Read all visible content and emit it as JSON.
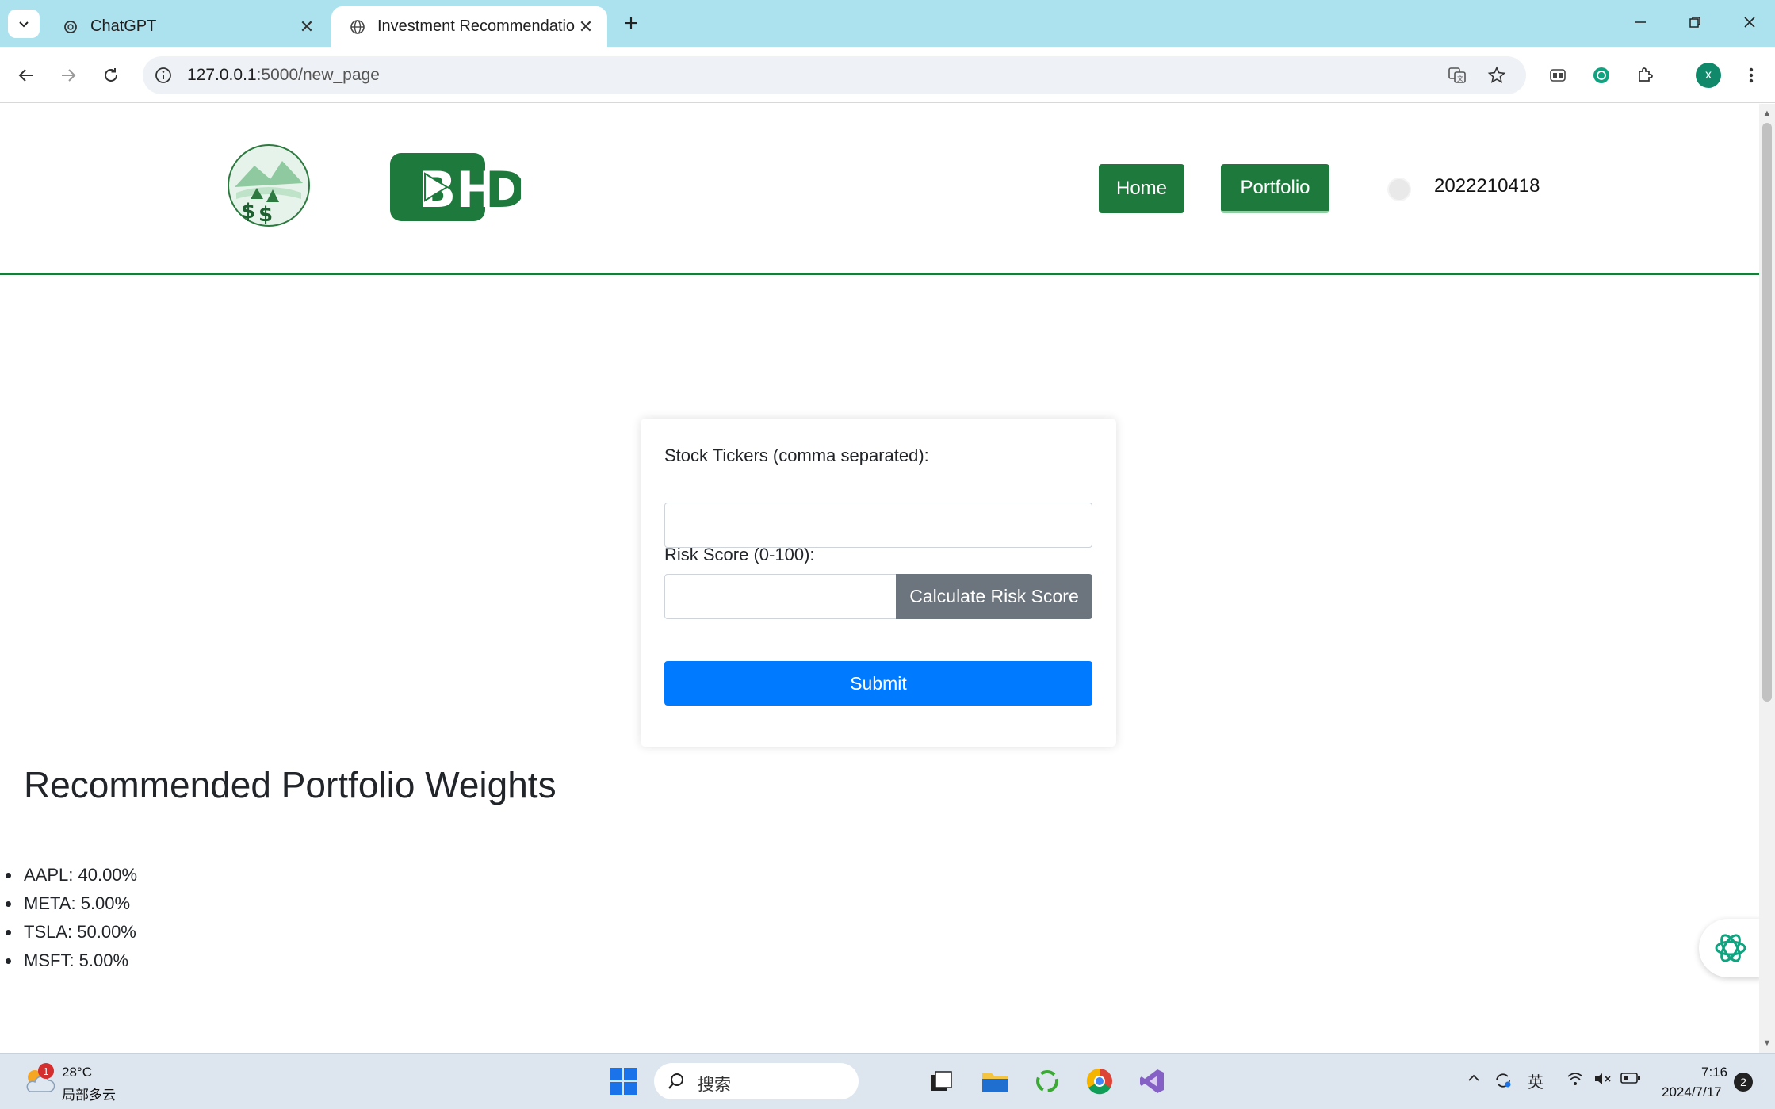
{
  "browser": {
    "tabs": [
      {
        "title": "ChatGPT",
        "active": false
      },
      {
        "title": "Investment Recommendatio",
        "active": true
      }
    ],
    "url_host": "127.0.0.1",
    "url_path": ":5000/new_page",
    "profile_initial": "x"
  },
  "header": {
    "nav": {
      "home": "Home",
      "portfolio": "Portfolio"
    },
    "user_id": "2022210418",
    "logo_text": "BHD"
  },
  "form": {
    "tickers_label": "Stock Tickers (comma separated):",
    "tickers_value": "",
    "risk_label": "Risk Score (0-100):",
    "risk_value": "",
    "calculate_label": "Calculate Risk Score",
    "submit_label": "Submit"
  },
  "results": {
    "title": "Recommended Portfolio Weights",
    "weights": [
      {
        "text": "AAPL: 40.00%"
      },
      {
        "text": "META: 5.00%"
      },
      {
        "text": "TSLA: 50.00%"
      },
      {
        "text": "MSFT: 5.00%"
      }
    ]
  },
  "taskbar": {
    "weather_badge": "1",
    "temperature": "28°C",
    "weather_desc": "局部多云",
    "search_placeholder": "搜索",
    "ime": "英",
    "time": "7:16",
    "date": "2024/7/17",
    "notifications": "2"
  },
  "colors": {
    "brand_green": "#1e7a3c",
    "primary_blue": "#007bff",
    "secondary_gray": "#6c757d",
    "tabstrip": "#ace1ee"
  }
}
